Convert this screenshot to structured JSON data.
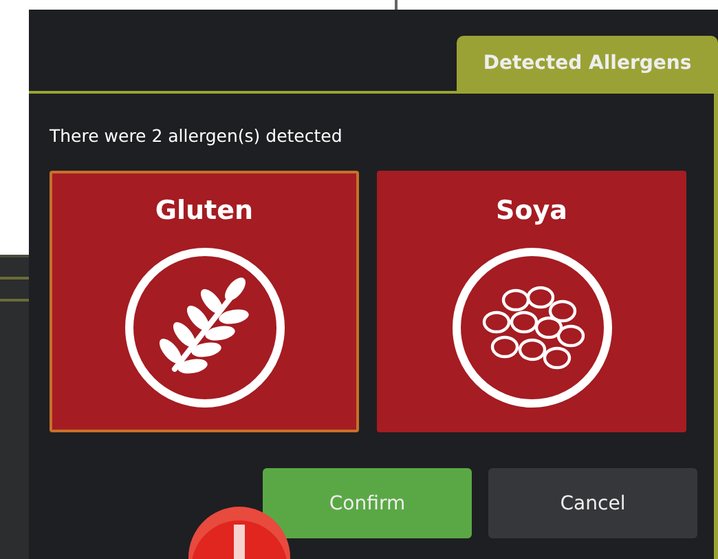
{
  "dialog": {
    "tabs": [
      {
        "label": "Detected Allergens",
        "selected": true
      }
    ],
    "message": "There were 2 allergen(s) detected",
    "allergens": [
      {
        "name": "Gluten",
        "kind": "wheat",
        "selected": true
      },
      {
        "name": "Soya",
        "kind": "soy",
        "selected": false
      }
    ],
    "buttons": [
      {
        "label": "Confirm",
        "kind": "primary"
      },
      {
        "label": "Cancel",
        "kind": "secondary"
      }
    ]
  }
}
